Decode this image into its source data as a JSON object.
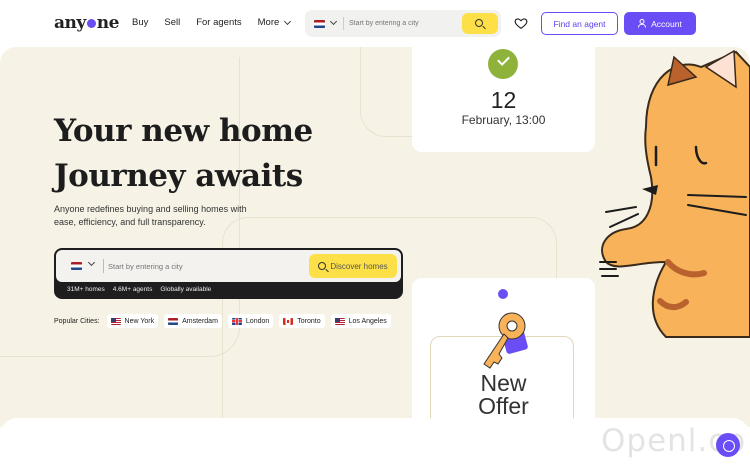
{
  "header": {
    "logo_text_pre": "any",
    "logo_text_post": "ne",
    "nav": [
      "Buy",
      "Sell",
      "For agents",
      "More"
    ],
    "search_placeholder": "Start by entering a city",
    "find_agent_label": "Find an agent",
    "account_label": "Account",
    "icons": [
      "netherlands-flag-icon",
      "chevron-down-icon",
      "search-icon",
      "heart-icon",
      "user-icon"
    ]
  },
  "hero": {
    "headline_line1": "Your new home",
    "headline_line2": "Journey awaits",
    "subline": "Anyone redefines buying and selling homes with ease, efficiency, and full transparency.",
    "search_placeholder": "Start by entering a city",
    "discover_label": "Discover homes",
    "stats": [
      "31M+ homes",
      "4.6M+ agents",
      "Globally available"
    ],
    "popular_label": "Popular Cities:",
    "cities": [
      {
        "name": "New York",
        "flag": "us-flag-icon"
      },
      {
        "name": "Amsterdam",
        "flag": "netherlands-flag-icon"
      },
      {
        "name": "London",
        "flag": "uk-flag-icon"
      },
      {
        "name": "Toronto",
        "flag": "canada-flag-icon"
      },
      {
        "name": "Los Angeles",
        "flag": "us-flag-icon"
      }
    ]
  },
  "date_card": {
    "day": "12",
    "month_time": "February, 13:00"
  },
  "offer_card": {
    "line1": "New",
    "line2": "Offer"
  },
  "watermark": "Openl.co",
  "colors": {
    "accent_purple": "#6a4df4",
    "accent_yellow": "#fde047",
    "hero_bg": "#f6f3e6",
    "check_green": "#8fb33a",
    "cat_orange": "#f7b25a"
  }
}
